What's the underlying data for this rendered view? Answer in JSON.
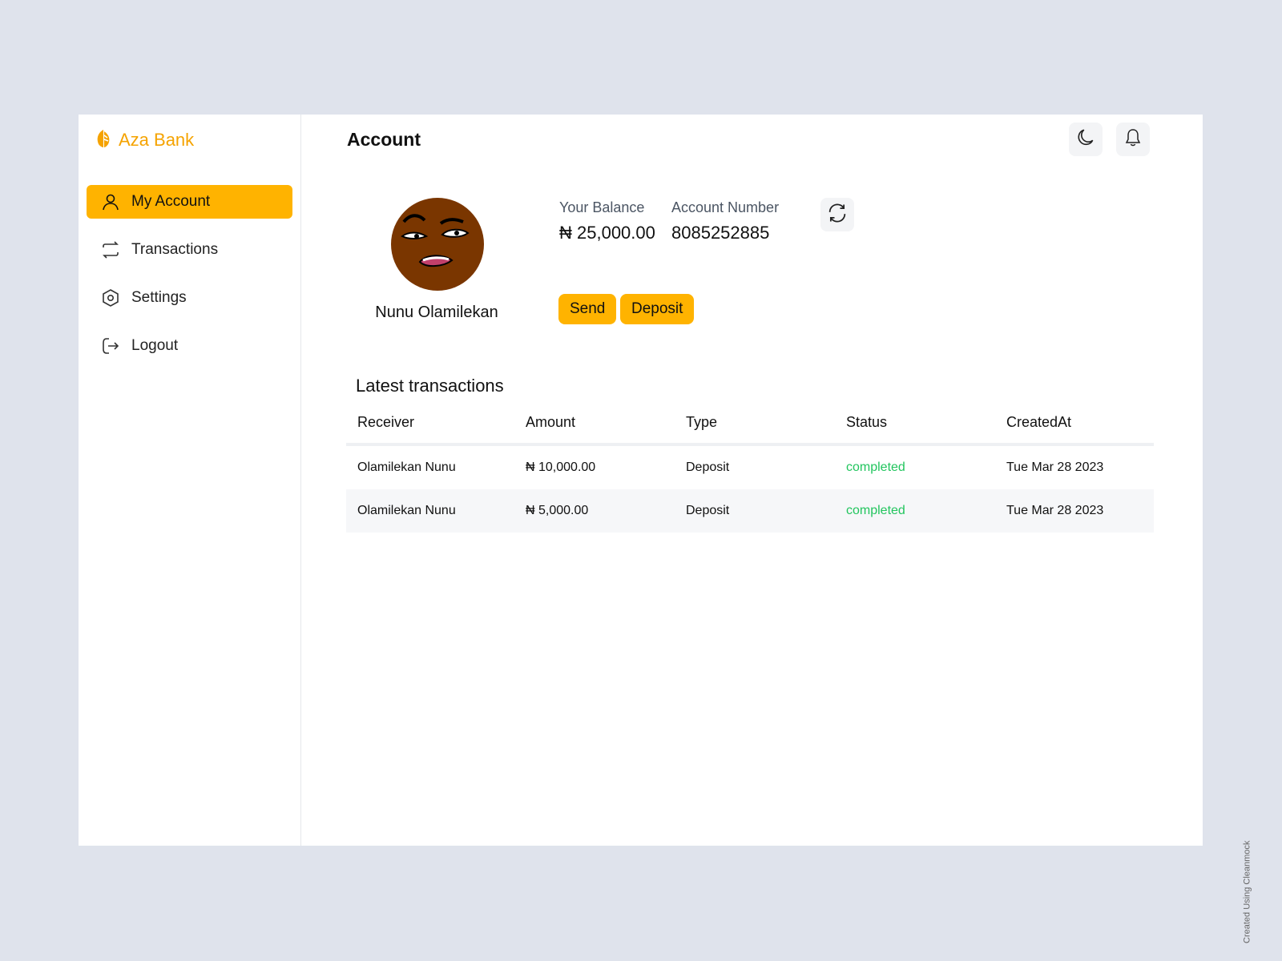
{
  "brand": {
    "name": "Aza Bank",
    "color": "#f5a300"
  },
  "sidebar": {
    "items": [
      {
        "label": "My Account",
        "icon": "user-icon",
        "active": true
      },
      {
        "label": "Transactions",
        "icon": "arrows-exchange-icon",
        "active": false
      },
      {
        "label": "Settings",
        "icon": "gear-hexagon-icon",
        "active": false
      },
      {
        "label": "Logout",
        "icon": "logout-icon",
        "active": false
      }
    ]
  },
  "header": {
    "title": "Account",
    "theme_toggle_icon": "moon-icon",
    "notifications_icon": "bell-icon"
  },
  "profile": {
    "name": "Nunu Olamilekan",
    "avatar_icon": "cartoon-face-avatar"
  },
  "account": {
    "balance_label": "Your Balance",
    "balance_value": "₦ 25,000.00",
    "number_label": "Account Number",
    "number_value": "8085252885",
    "refresh_icon": "refresh-icon"
  },
  "actions": {
    "send_label": "Send",
    "deposit_label": "Deposit"
  },
  "transactions": {
    "title": "Latest transactions",
    "columns": [
      "Receiver",
      "Amount",
      "Type",
      "Status",
      "CreatedAt"
    ],
    "rows": [
      [
        "Olamilekan Nunu",
        "₦ 10,000.00",
        "Deposit",
        "completed",
        "Tue Mar 28 2023"
      ],
      [
        "Olamilekan Nunu",
        "₦ 5,000.00",
        "Deposit",
        "completed",
        "Tue Mar 28 2023"
      ]
    ]
  },
  "colors": {
    "accent": "#ffb300",
    "status_completed": "#22c55e",
    "page_bg": "#dfe3ec"
  },
  "watermark": "Created Using Cleanmock"
}
